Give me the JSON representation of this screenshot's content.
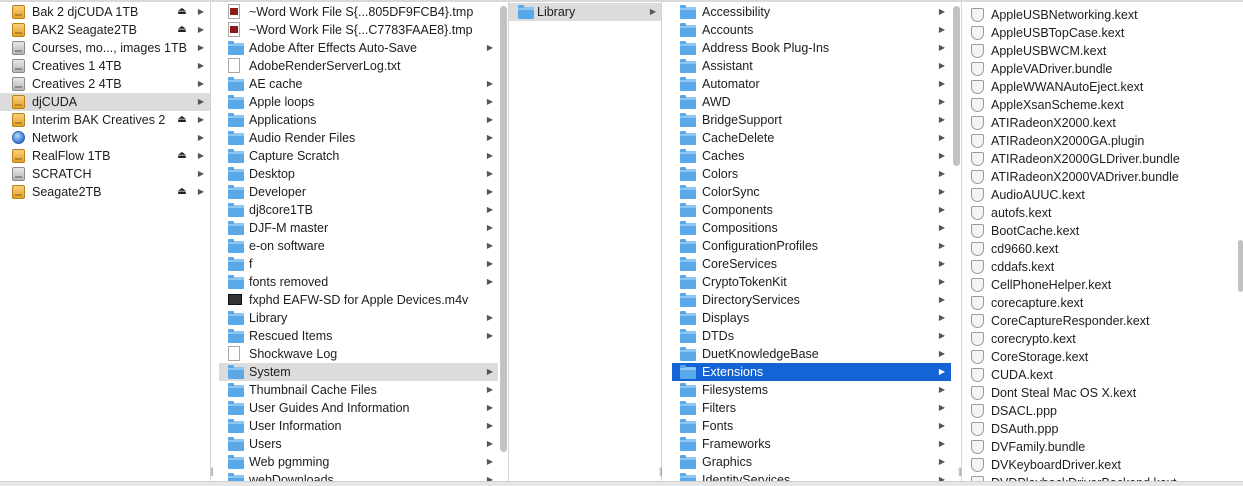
{
  "volumes": [
    {
      "label": "Bak 2 djCUDA  1TB",
      "icon": "drive",
      "eject": true
    },
    {
      "label": "BAK2 Seagate2TB",
      "icon": "drive",
      "eject": true
    },
    {
      "label": "Courses, mo..., images 1TB",
      "icon": "drive-gray",
      "eject": false
    },
    {
      "label": "Creatives 1  4TB",
      "icon": "drive-gray",
      "eject": false
    },
    {
      "label": "Creatives 2  4TB",
      "icon": "drive-gray",
      "eject": false
    },
    {
      "label": "djCUDA",
      "icon": "drive",
      "eject": false,
      "selected": "gray"
    },
    {
      "label": "Interim BAK Creatives 2",
      "icon": "drive",
      "eject": true
    },
    {
      "label": "Network",
      "icon": "globe",
      "eject": false
    },
    {
      "label": "RealFlow 1TB",
      "icon": "drive",
      "eject": true
    },
    {
      "label": "SCRATCH",
      "icon": "drive-gray",
      "eject": false
    },
    {
      "label": "Seagate2TB",
      "icon": "drive",
      "eject": true
    }
  ],
  "djcuda_items": [
    {
      "label": "~Word Work File S{...805DF9FCB4}.tmp",
      "icon": "docw",
      "arrow": false
    },
    {
      "label": "~Word Work File S{...C7783FAAE8}.tmp",
      "icon": "docw",
      "arrow": false
    },
    {
      "label": "Adobe After Effects Auto-Save",
      "icon": "folder",
      "arrow": true
    },
    {
      "label": "AdobeRenderServerLog.txt",
      "icon": "doc",
      "arrow": false
    },
    {
      "label": "AE cache",
      "icon": "folder",
      "arrow": true
    },
    {
      "label": "Apple loops",
      "icon": "folder",
      "arrow": true
    },
    {
      "label": "Applications",
      "icon": "folder",
      "arrow": true
    },
    {
      "label": "Audio Render Files",
      "icon": "folder",
      "arrow": true
    },
    {
      "label": "Capture Scratch",
      "icon": "folder",
      "arrow": true
    },
    {
      "label": "Desktop",
      "icon": "folder",
      "arrow": true
    },
    {
      "label": "Developer",
      "icon": "folder",
      "arrow": true
    },
    {
      "label": "dj8core1TB",
      "icon": "folder",
      "arrow": true
    },
    {
      "label": "DJF-M master",
      "icon": "folder",
      "arrow": true
    },
    {
      "label": "e-on software",
      "icon": "folder",
      "arrow": true
    },
    {
      "label": "f",
      "icon": "folder",
      "arrow": true
    },
    {
      "label": "fonts removed",
      "icon": "folder",
      "arrow": true
    },
    {
      "label": "fxphd EAFW-SD for Apple Devices.m4v",
      "icon": "movie",
      "arrow": false
    },
    {
      "label": "Library",
      "icon": "folder",
      "arrow": true
    },
    {
      "label": "Rescued Items",
      "icon": "folder",
      "arrow": true
    },
    {
      "label": "Shockwave Log",
      "icon": "doc",
      "arrow": false
    },
    {
      "label": "System",
      "icon": "folder",
      "arrow": true,
      "selected": "gray"
    },
    {
      "label": "Thumbnail Cache Files",
      "icon": "folder",
      "arrow": true
    },
    {
      "label": "User Guides And Information",
      "icon": "folder",
      "arrow": true
    },
    {
      "label": "User Information",
      "icon": "folder",
      "arrow": true
    },
    {
      "label": "Users",
      "icon": "folder",
      "arrow": true
    },
    {
      "label": "Web pgmming",
      "icon": "folder",
      "arrow": true
    },
    {
      "label": "webDownloads",
      "icon": "folder",
      "arrow": true
    }
  ],
  "system_items": [
    {
      "label": "Library",
      "icon": "folder",
      "arrow": true,
      "selected": "gray"
    }
  ],
  "library_items": [
    {
      "label": "Accessibility"
    },
    {
      "label": "Accounts"
    },
    {
      "label": "Address Book Plug-Ins"
    },
    {
      "label": "Assistant"
    },
    {
      "label": "Automator"
    },
    {
      "label": "AWD"
    },
    {
      "label": "BridgeSupport"
    },
    {
      "label": "CacheDelete"
    },
    {
      "label": "Caches"
    },
    {
      "label": "Colors"
    },
    {
      "label": "ColorSync"
    },
    {
      "label": "Components"
    },
    {
      "label": "Compositions"
    },
    {
      "label": "ConfigurationProfiles"
    },
    {
      "label": "CoreServices"
    },
    {
      "label": "CryptoTokenKit"
    },
    {
      "label": "DirectoryServices"
    },
    {
      "label": "Displays"
    },
    {
      "label": "DTDs"
    },
    {
      "label": "DuetKnowledgeBase"
    },
    {
      "label": "Extensions",
      "selected": "blue"
    },
    {
      "label": "Filesystems"
    },
    {
      "label": "Filters"
    },
    {
      "label": "Fonts"
    },
    {
      "label": "Frameworks"
    },
    {
      "label": "Graphics"
    },
    {
      "label": "IdentityServices"
    }
  ],
  "extensions_items": [
    "AppleUSBNetworking.kext",
    "AppleUSBTopCase.kext",
    "AppleUSBWCM.kext",
    "AppleVADriver.bundle",
    "AppleWWANAutoEject.kext",
    "AppleXsanScheme.kext",
    "ATIRadeonX2000.kext",
    "ATIRadeonX2000GA.plugin",
    "ATIRadeonX2000GLDriver.bundle",
    "ATIRadeonX2000VADriver.bundle",
    "AudioAUUC.kext",
    "autofs.kext",
    "BootCache.kext",
    "cd9660.kext",
    "cddafs.kext",
    "CellPhoneHelper.kext",
    "corecapture.kext",
    "CoreCaptureResponder.kext",
    "corecrypto.kext",
    "CoreStorage.kext",
    "CUDA.kext",
    "Dont Steal Mac OS X.kext",
    "DSACL.ppp",
    "DSAuth.ppp",
    "DVFamily.bundle",
    "DVKeyboardDriver.kext",
    "DVDPlaybackDriverBackend.kext"
  ]
}
